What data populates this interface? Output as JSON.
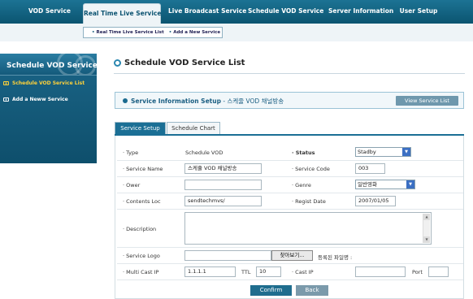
{
  "topnav": {
    "tabs": [
      {
        "label": "VOD Service"
      },
      {
        "label": "Real Time Live Service"
      },
      {
        "label": "Live Broadcast Service"
      },
      {
        "label": "Schedule VOD Service"
      },
      {
        "label": "Server Information"
      },
      {
        "label": "User Setup"
      }
    ],
    "active_index": 1
  },
  "subnav": {
    "items": [
      {
        "label": "Real Time Live Service List"
      },
      {
        "label": "Add a New Service"
      }
    ]
  },
  "sidebar": {
    "title": "Schedule VOD Service",
    "items": [
      {
        "label": "Schedule VOD Service List",
        "active": true
      },
      {
        "label": "Add a Neww Service",
        "active": false
      }
    ]
  },
  "page": {
    "title": "Schedule VOD Service List"
  },
  "info_box": {
    "label": "Service Information Setup",
    "separator": " - ",
    "service_name": "스케줄 VOD 채널방송",
    "view_button": "View Service List"
  },
  "tabs": [
    {
      "label": "Service Setup"
    },
    {
      "label": "Schedule Chart"
    }
  ],
  "form": {
    "type": {
      "label": "Type",
      "value": "Schedule VOD"
    },
    "status": {
      "label": "Status",
      "value": "Stadby"
    },
    "service_name": {
      "label": "Service Name",
      "value": "스케쥴 VOD 채널방송"
    },
    "service_code": {
      "label": "Service Code",
      "value": "003"
    },
    "ower": {
      "label": "Ower",
      "value": ""
    },
    "genre": {
      "label": "Genre",
      "value": "일반영화"
    },
    "contents_loc": {
      "label": "Contents Loc",
      "value": "sendtechmvs/"
    },
    "regist_date": {
      "label": "Regist Date",
      "value": "2007/01/05"
    },
    "description": {
      "label": "Description",
      "value": ""
    },
    "service_logo": {
      "label": "Service Logo",
      "value": "",
      "browse": "찾아보기...",
      "registered": "등록된 파일명 :"
    },
    "multicast_ip": {
      "label": "Multi Cast IP",
      "value": "1.1.1.1"
    },
    "ttl": {
      "label": "TTL",
      "value": "10"
    },
    "cast_ip": {
      "label": "Cast IP",
      "value": ""
    },
    "port": {
      "label": "Port",
      "value": ""
    },
    "bullet": "·"
  },
  "buttons": {
    "confirm": "Confirm",
    "back": "Back"
  },
  "colors": {
    "nav": "#0d5a7a",
    "accent": "#1b6f95",
    "active_link": "#ffd23a"
  }
}
